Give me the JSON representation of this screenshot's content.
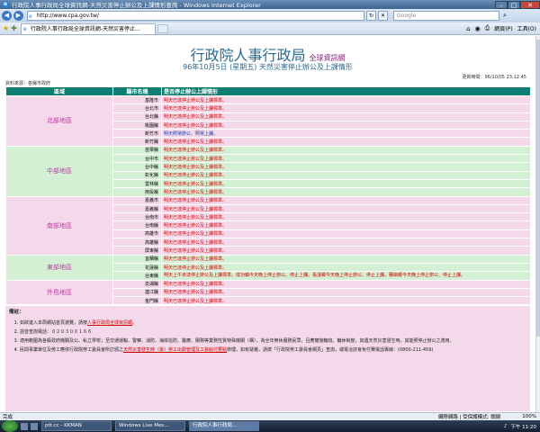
{
  "window": {
    "title": "行政院人事行政局全球資訊網-天然災害停止辦公及上課情形查詢 - Windows Internet Explorer"
  },
  "address": {
    "url": "http://www.cpa.gov.tw/",
    "search_placeholder": "Google"
  },
  "tabs": [
    {
      "label": "行政院人事行政局全球資訊網-天然災害停止..."
    }
  ],
  "commands": {
    "page": "網頁(P)",
    "tools": "工具(O)"
  },
  "page": {
    "org": "行政院人事行政局",
    "site": "全球資訊網",
    "subtitle": "96年10月5日 (星期五) 天然災害停止辦公及上課情形",
    "updated": "更新時間：96/10/05 23:12:45",
    "source": "資料來源：各縣市政府"
  },
  "table": {
    "headers": {
      "region": "區域",
      "county": "縣市名稱",
      "status": "是否停止辦公上課情形"
    },
    "groups": [
      {
        "region": "北部地區",
        "bg": "pink",
        "rows": [
          {
            "county": "基隆市",
            "status": "明天已達停止辦公及上課標準。",
            "color": "red"
          },
          {
            "county": "台北市",
            "status": "明天已達停止辦公及上課標準。",
            "color": "red"
          },
          {
            "county": "台北縣",
            "status": "明天已達停止辦公及上課標準。",
            "color": "red"
          },
          {
            "county": "桃園縣",
            "status": "明天已達停止辦公及上課標準。",
            "color": "red"
          },
          {
            "county": "新竹市",
            "status": "明天照常辦公、照常上課。",
            "color": "blue"
          },
          {
            "county": "新竹縣",
            "status": "明天已達停止辦公及上課標準。",
            "color": "red"
          }
        ]
      },
      {
        "region": "中部地區",
        "bg": "green",
        "rows": [
          {
            "county": "苗栗縣",
            "status": "明天已達停止辦公及上課標準。",
            "color": "red"
          },
          {
            "county": "台中市",
            "status": "明天已達停止辦公及上課標準。",
            "color": "red"
          },
          {
            "county": "台中縣",
            "status": "明天已達停止辦公及上課標準。",
            "color": "red"
          },
          {
            "county": "彰化縣",
            "status": "明天已達停止辦公及上課標準。",
            "color": "red"
          },
          {
            "county": "雲林縣",
            "status": "明天已達停止辦公及上課標準。",
            "color": "red"
          },
          {
            "county": "南投縣",
            "status": "明天已達停止辦公及上課標準。",
            "color": "red"
          }
        ]
      },
      {
        "region": "南部地區",
        "bg": "pink",
        "rows": [
          {
            "county": "嘉義市",
            "status": "明天已達停止辦公及上課標準。",
            "color": "red"
          },
          {
            "county": "嘉義縣",
            "status": "明天已達停止辦公及上課標準。",
            "color": "red"
          },
          {
            "county": "台南市",
            "status": "明天已達停止辦公及上課標準。",
            "color": "red"
          },
          {
            "county": "台南縣",
            "status": "明天已達停止辦公及上課標準。",
            "color": "red"
          },
          {
            "county": "高雄市",
            "status": "明天已達停止辦公及上課標準。",
            "color": "red"
          },
          {
            "county": "高雄縣",
            "status": "明天已達停止辦公及上課標準。",
            "color": "red"
          },
          {
            "county": "屏東縣",
            "status": "明天已達停止辦公及上課標準。",
            "color": "red"
          }
        ]
      },
      {
        "region": "東部地區",
        "bg": "green",
        "rows": [
          {
            "county": "宜蘭縣",
            "status": "明天已達停止辦公及上課標準。",
            "color": "red"
          },
          {
            "county": "花蓮縣",
            "status": "明天已達停止辦公及上課標準。",
            "color": "red"
          },
          {
            "county": "台東縣",
            "status": "明天上午未達停止辦公及上課標準。成功鎮今天晚上停止辦公、停止上課。長濱鄉今天晚上停止辦公、停止上課。蘭嶼鄉今天晚上停止辦公、停止上課。",
            "color": "red"
          }
        ]
      },
      {
        "region": "外島地區",
        "bg": "pink",
        "rows": [
          {
            "county": "澎湖縣",
            "status": "明天已達停止辦公及上課標準。",
            "color": "red"
          },
          {
            "county": "連江縣",
            "status": "明天已達停止辦公及上課標準。",
            "color": "red"
          },
          {
            "county": "金門縣",
            "status": "明天已達停止辦公及上課標準。",
            "color": "red"
          }
        ]
      }
    ]
  },
  "notes": {
    "title": "備註：",
    "items": [
      {
        "text": "如欲進入本局網站首頁瀏覽，請按",
        "link": "人事行政局全球資訊網",
        "after": "。"
      },
      {
        "text": "語音查詢電話：０２０３００１６６",
        "link": "",
        "after": ""
      },
      {
        "text": "適用範圍為各級政府機關及公、私立學校；至交通運輸、警察、消防、海岸巡防、醫療、關務等業務性質特殊機關（構），為全年無休服務民眾，且應實施輪班、輪休制度，如遇天然災害發生時，其能照停止辦公之適用。",
        "link": "",
        "after": ""
      },
      {
        "text": "民間事業單位及勞工應依行政院勞工委員會所訂頒之",
        "link": "天然災害發生時（後）勞工出勤管理及工資給付要點",
        "after": "辦理，如有疑義，請按「行政院勞工委員會網頁」查詢，或電洽該會免付費電話專線：(0800-211-459)"
      }
    ]
  },
  "statusbar": {
    "left": "完成",
    "zone": "網際網路 | 受保護模式: 關閉",
    "zoom": "100%"
  },
  "taskbar": {
    "tasks": [
      "ptt.cc - KKMAN",
      "Windows Live Mes...",
      "行政院人事行政局..."
    ],
    "clock": "下午 11:20"
  }
}
